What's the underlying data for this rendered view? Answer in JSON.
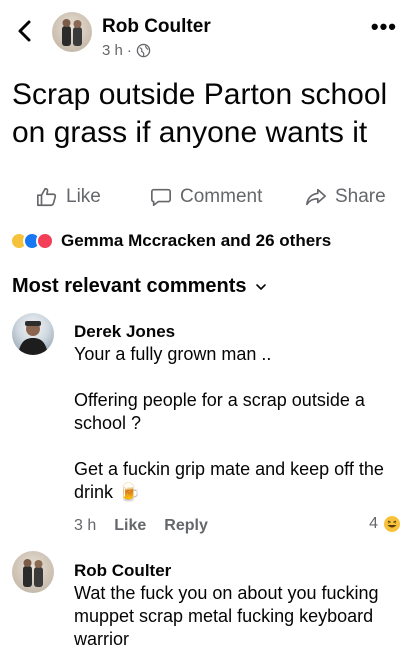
{
  "post": {
    "author": "Rob Coulter",
    "time": "3 h",
    "separator": "·",
    "text": "Scrap outside Parton school on grass if anyone wants it"
  },
  "actions": {
    "like": "Like",
    "comment": "Comment",
    "share": "Share"
  },
  "reactions": {
    "summary": "Gemma Mccracken and 26 others"
  },
  "comments_header": {
    "label": "Most relevant comments"
  },
  "comments": [
    {
      "author": "Derek Jones",
      "text": "Your a fully grown man ..\n\nOffering people for a scrap outside a school ?\n\nGet a fuckin grip mate and keep off the drink 🍺",
      "time": "3 h",
      "like_label": "Like",
      "reply_label": "Reply",
      "reaction_count": "4"
    },
    {
      "author": "Rob Coulter",
      "text": "Wat the fuck you on about you fucking muppet scrap metal fucking keyboard warrior"
    }
  ],
  "colors": {
    "secondary_text": "#65676b",
    "like_blue": "#1877f2",
    "love_red": "#f33e58",
    "haha_yellow": "#f7c23b"
  }
}
